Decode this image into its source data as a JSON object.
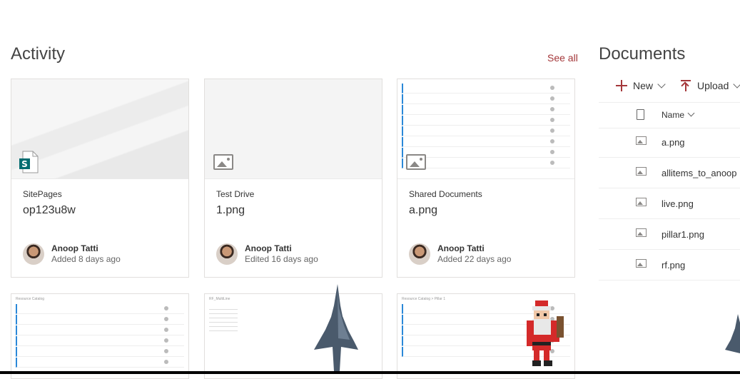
{
  "activity": {
    "title": "Activity",
    "see_all": "See all",
    "cards": [
      {
        "site": "SitePages",
        "file": "op123u8w",
        "author": "Anoop Tatti",
        "action": "Added 8 days ago"
      },
      {
        "site": "Test Drive",
        "file": "1.png",
        "author": "Anoop Tatti",
        "action": "Edited 16 days ago"
      },
      {
        "site": "Shared Documents",
        "file": "a.png",
        "author": "Anoop Tatti",
        "action": "Added 22 days ago"
      }
    ],
    "lower_cards": [
      {
        "preview_title": "Resource Catalog"
      },
      {
        "preview_title": "RF_MultiLine"
      },
      {
        "preview_title": "Resource Catalog > Pillar 1"
      }
    ]
  },
  "documents": {
    "title": "Documents",
    "new_label": "New",
    "upload_label": "Upload",
    "name_column": "Name",
    "files": [
      "a.png",
      "allitems_to_anoop",
      "live.png",
      "pillar1.png",
      "rf.png"
    ]
  },
  "colors": {
    "accent": "#a4373a",
    "border": "#e1dfdd",
    "text": "#333333"
  }
}
